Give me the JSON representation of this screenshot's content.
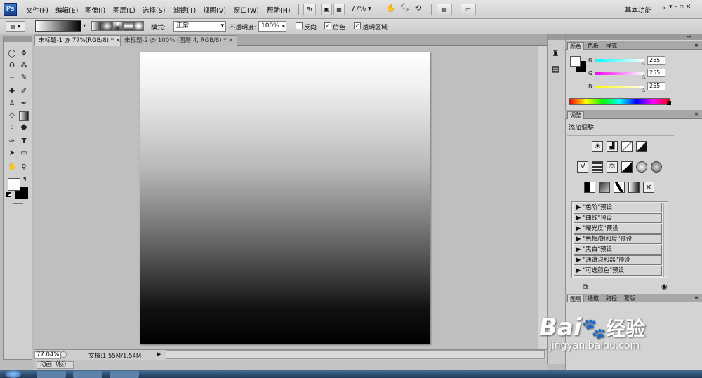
{
  "app": {
    "logo_text": "Ps"
  },
  "menubar": {
    "items": [
      {
        "label": "文件(F)"
      },
      {
        "label": "编辑(E)"
      },
      {
        "label": "图像(I)"
      },
      {
        "label": "图层(L)"
      },
      {
        "label": "选择(S)"
      },
      {
        "label": "滤镜(T)"
      },
      {
        "label": "视图(V)"
      },
      {
        "label": "窗口(W)"
      },
      {
        "label": "帮助(H)"
      }
    ],
    "bridge_label": "Br",
    "zoom_label": "77%",
    "workspace_label": "基本功能",
    "window_controls": "▾  –  ▫  ✕"
  },
  "options": {
    "mode_label": "模式:",
    "mode_value": "正常",
    "opacity_label": "不透明度:",
    "opacity_value": "100%",
    "reverse_label": "反向",
    "dither_label": "仿色",
    "transparency_label": "透明区域"
  },
  "tabs": [
    {
      "label": "未标题-1 @ 77%(RGB/8) * ×"
    },
    {
      "label": "未标题-2 @ 100% (图层 4, RGB/8) * ×"
    }
  ],
  "status": {
    "zoom": "77.04%",
    "doc_info": "文档:1.55M/1.54M",
    "animation_label": "动画（帧）"
  },
  "color_panel": {
    "tabs": [
      {
        "label": "颜色"
      },
      {
        "label": "色板"
      },
      {
        "label": "样式"
      }
    ],
    "channels": [
      {
        "name": "R",
        "value": "255"
      },
      {
        "name": "G",
        "value": "255"
      },
      {
        "name": "B",
        "value": "255"
      }
    ]
  },
  "adjust_panel": {
    "tab_label": "调整",
    "title": "添加调整",
    "presets": [
      {
        "label": "\"色阶\"预设"
      },
      {
        "label": "\"曲线\"预设"
      },
      {
        "label": "\"曝光度\"预设"
      },
      {
        "label": "\"色相/饱和度\"预设"
      },
      {
        "label": "\"黑白\"预设"
      },
      {
        "label": "\"通道混和器\"预设"
      },
      {
        "label": "\"可选颜色\"预设"
      }
    ]
  },
  "layers_panel": {
    "tabs": [
      {
        "label": "图层"
      },
      {
        "label": "通道"
      },
      {
        "label": "路径"
      },
      {
        "label": "蒙版"
      }
    ]
  },
  "watermark": {
    "brand": "Bai",
    "paw": "🐾",
    "brand2": "经验",
    "url": "jingyan.baidu.com"
  },
  "colors": {
    "ui_gray": "#d3d3d3",
    "workspace": "#bfbfbf",
    "accent_blue": "#2a5a9a"
  }
}
